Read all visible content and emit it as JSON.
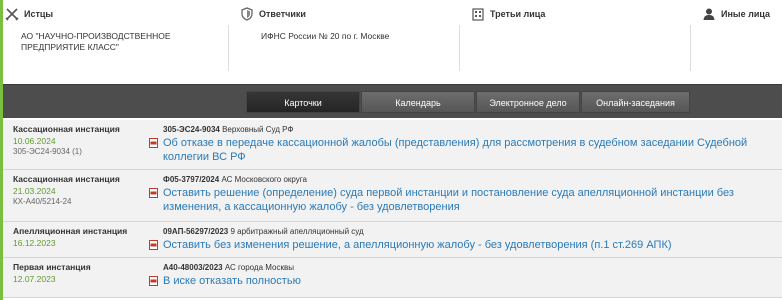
{
  "parties": {
    "plaintiffs": {
      "title": "Истцы",
      "icon": "crossed-swords-icon",
      "name": "АО \"НАУЧНО-ПРОИЗВОДСТВЕННОЕ ПРЕДПРИЯТИЕ КЛАСС\""
    },
    "defendants": {
      "title": "Ответчики",
      "icon": "shield-icon",
      "name": "ИФНС России № 20 по г. Москве"
    },
    "third_parties": {
      "title": "Третьи лица",
      "icon": "building-icon",
      "name": ""
    },
    "others": {
      "title": "Иные лица",
      "icon": "person-icon",
      "name": ""
    }
  },
  "tabs": [
    {
      "label": "Карточки",
      "active": true
    },
    {
      "label": "Календарь",
      "active": false
    },
    {
      "label": "Электронное дело",
      "active": false
    },
    {
      "label": "Онлайн-заседания",
      "active": false
    }
  ],
  "cases": [
    {
      "instance": "Кассационная инстанция",
      "date": "10.06.2024",
      "case_no": "305-ЭС24-9034 (1)",
      "doc_number": "305-ЭС24-9034",
      "court": "Верховный Суд РФ",
      "document": "Об отказе в передаче кассационной жалобы (представления) для рассмотрения в судебном заседании Судебной коллегии ВС РФ"
    },
    {
      "instance": "Кассационная инстанция",
      "date": "21.03.2024",
      "case_no": "КХ-А40/5214-24",
      "doc_number": "Ф05-3797/2024",
      "court": "АС Московского округа",
      "document": "Оставить решение (определение) суда первой инстанции и постановление суда апелляционной инстанции без изменения, а кассационную жалобу - без удовлетворения"
    },
    {
      "instance": "Апелляционная инстанция",
      "date": "16.12.2023",
      "case_no": "",
      "doc_number": "09АП-56297/2023",
      "court": "9 арбитражный апелляционный суд",
      "document": "Оставить без изменения решение, а апелляционную жалобу - без удовлетворения (п.1 ст.269 АПК)"
    },
    {
      "instance": "Первая инстанция",
      "date": "12.07.2023",
      "case_no": "",
      "doc_number": "А40-48003/2023",
      "court": "АС города Москвы",
      "document": "В иске отказать полностью"
    }
  ],
  "colors": {
    "accent_green": "#7bbf40",
    "link_blue": "#2a7ab8",
    "date_green": "#5e9c2c",
    "tabbar": "#4d4d4d"
  }
}
